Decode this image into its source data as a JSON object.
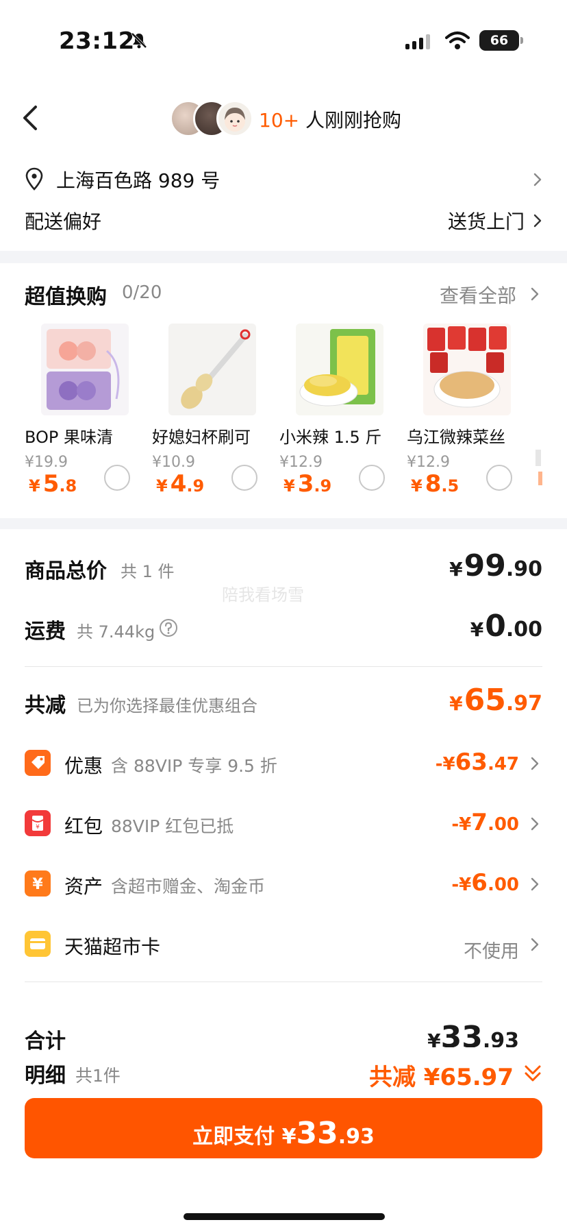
{
  "status_bar": {
    "time": "23:12",
    "battery": "66"
  },
  "header": {
    "buyers_count": "10+",
    "buyers_text": " 人刚刚抢购"
  },
  "address": {
    "text": "上海百色路 989 号"
  },
  "delivery": {
    "label": "配送偏好",
    "value": "送货上门"
  },
  "exchange": {
    "title": "超值换购",
    "count": "0/20",
    "view_all": "查看全部",
    "items": [
      {
        "name": "BOP 果味清",
        "original": "¥19.9",
        "currency": "¥",
        "int": "5",
        "dec": ".8"
      },
      {
        "name": "好媳妇杯刷可",
        "original": "¥10.9",
        "currency": "¥",
        "int": "4",
        "dec": ".9"
      },
      {
        "name": "小米辣 1.5 斤",
        "original": "¥12.9",
        "currency": "¥",
        "int": "3",
        "dec": ".9"
      },
      {
        "name": "乌江微辣菜丝",
        "original": "¥12.9",
        "currency": "¥",
        "int": "8",
        "dec": ".5"
      }
    ]
  },
  "summary": {
    "goods": {
      "label": "商品总价",
      "sub": "共 1 件",
      "cur": "¥",
      "int": "99",
      "dec": ".90"
    },
    "shipping": {
      "label": "运费",
      "sub": "共 7.44kg",
      "cur": "¥",
      "int": "0",
      "dec": ".00"
    },
    "reduce": {
      "label": "共减",
      "sub": "已为你选择最佳优惠组合",
      "cur": "¥",
      "int": "65",
      "dec": ".97"
    },
    "discounts": [
      {
        "name": "优惠",
        "sub": "含 88VIP 专享 9.5 折",
        "prefix": "-¥",
        "int": "63",
        "dec": ".47",
        "color": "#ff6a1a"
      },
      {
        "name": "红包",
        "sub": "88VIP 红包已抵",
        "prefix": "-¥",
        "int": "7",
        "dec": ".00",
        "color": "#f23a3a"
      },
      {
        "name": "资产",
        "sub": "含超市赠金、淘金币",
        "prefix": "-¥",
        "int": "6",
        "dec": ".00",
        "color": "#ff7a1a"
      },
      {
        "name": "天猫超市卡",
        "sub": "",
        "value": "不使用",
        "color": "#ffc535"
      }
    ]
  },
  "bottom": {
    "total_label": "合计",
    "total_cur": "¥",
    "total_int": "33",
    "total_dec": ".93",
    "detail_label": "明细",
    "detail_sub": "共1件",
    "reduce_text": "共减 ¥65.97",
    "pay_label": "立即支付 ¥",
    "pay_int": "33",
    "pay_dec": ".93"
  },
  "watermark": "陪我看场雪",
  "colors": {
    "accent": "#ff5500",
    "section_bg": "#f3f4f7"
  }
}
